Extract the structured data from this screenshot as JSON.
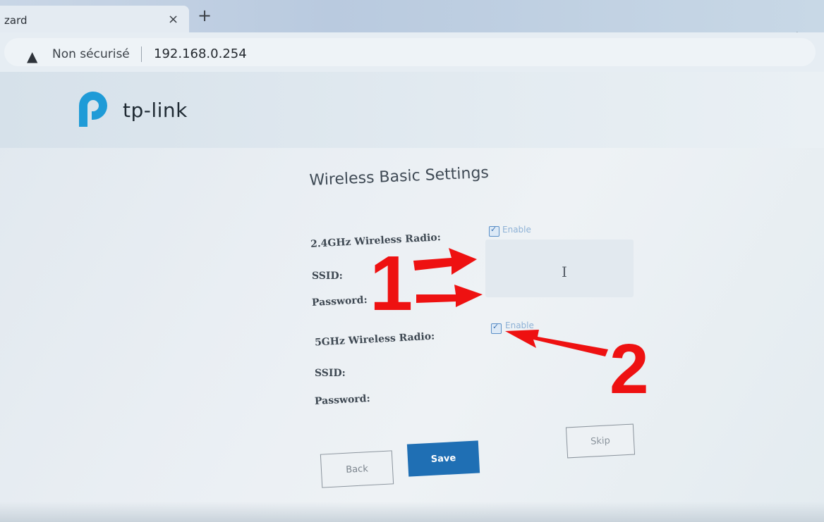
{
  "browser": {
    "tab_title": "zard",
    "tab_close": "×",
    "new_tab": "+",
    "warning_icon": "warning-triangle-icon",
    "security_text": "Non sécurisé",
    "url": "192.168.0.254"
  },
  "brand": {
    "logo_text": "tp-link",
    "accent_color": "#1f9bd7"
  },
  "form": {
    "title": "Wireless Basic Settings",
    "radio_24": {
      "label": "2.4GHz Wireless Radio:",
      "enable_label": "Enable",
      "checked": true,
      "ssid_label": "SSID:",
      "password_label": "Password:"
    },
    "radio_5": {
      "label": "5GHz Wireless Radio:",
      "enable_label": "Enable",
      "checked": true,
      "ssid_label": "SSID:",
      "password_label": "Password:"
    }
  },
  "buttons": {
    "back": "Back",
    "save": "Save",
    "skip": "Skip"
  },
  "annotations": {
    "label_1": "1",
    "label_2": "2",
    "color": "#ee1111"
  }
}
